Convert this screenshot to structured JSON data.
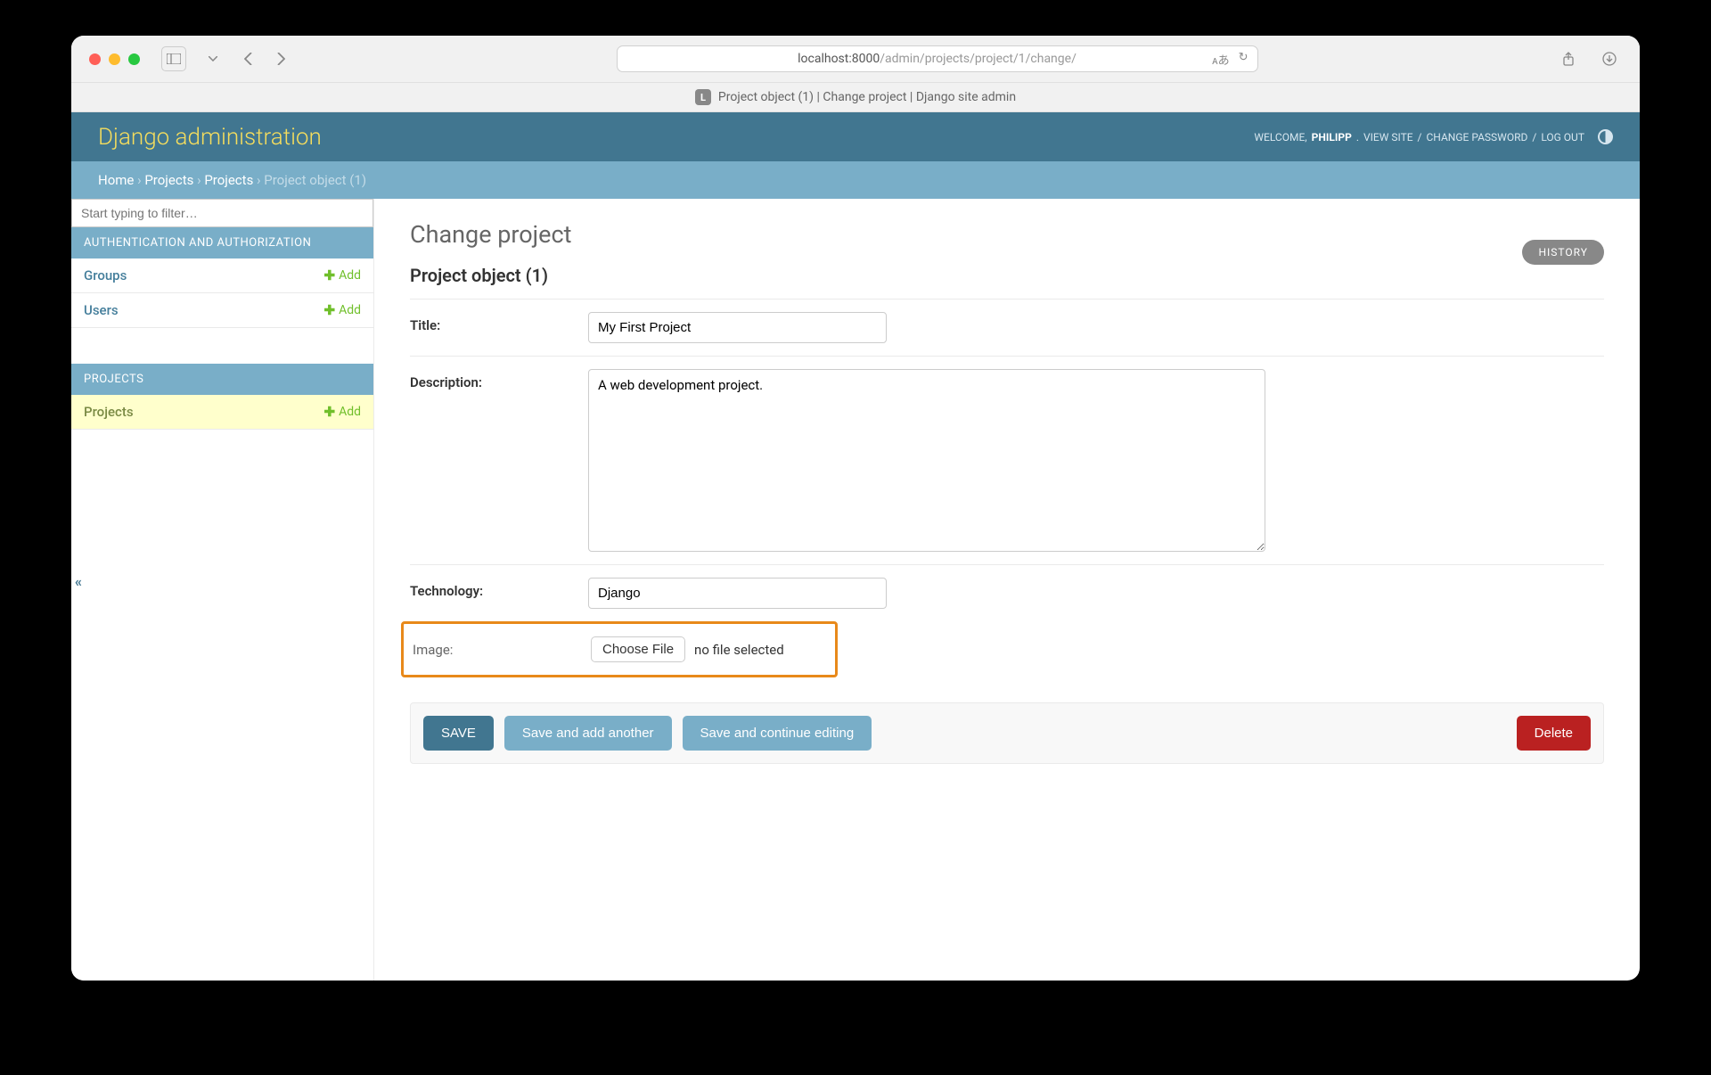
{
  "browser": {
    "url_prefix": "localhost:8000",
    "url_path": "/admin/projects/project/1/change/",
    "tab_title": "Project object (1) | Change project | Django site admin",
    "tab_favicon": "L"
  },
  "header": {
    "site_title": "Django administration",
    "welcome": "WELCOME, ",
    "username": "PHILIPP",
    "view_site": "VIEW SITE",
    "change_password": "CHANGE PASSWORD",
    "log_out": "LOG OUT"
  },
  "breadcrumbs": {
    "home": "Home",
    "app": "Projects",
    "model": "Projects",
    "current": "Project object (1)"
  },
  "sidebar": {
    "filter_placeholder": "Start typing to filter…",
    "sections": [
      {
        "title": "AUTHENTICATION AND AUTHORIZATION",
        "models": [
          {
            "name": "Groups",
            "add": "Add"
          },
          {
            "name": "Users",
            "add": "Add"
          }
        ]
      },
      {
        "title": "PROJECTS",
        "models": [
          {
            "name": "Projects",
            "add": "Add",
            "active": true
          }
        ]
      }
    ]
  },
  "content": {
    "page_title": "Change project",
    "object_title": "Project object (1)",
    "history": "HISTORY",
    "fields": {
      "title_label": "Title:",
      "title_value": "My First Project",
      "description_label": "Description:",
      "description_value": "A web development project.",
      "technology_label": "Technology:",
      "technology_value": "Django",
      "image_label": "Image:",
      "choose_file": "Choose File",
      "no_file": "no file selected"
    },
    "buttons": {
      "save": "SAVE",
      "save_add": "Save and add another",
      "save_continue": "Save and continue editing",
      "delete": "Delete"
    }
  }
}
